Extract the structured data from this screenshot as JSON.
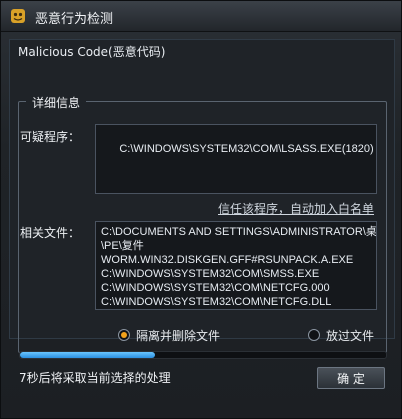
{
  "window": {
    "title": "恶意行为检测",
    "panel_caption": "Malicious Code(恶意代码)",
    "group_title": "详细信息"
  },
  "details": {
    "program_label": "可疑程序：",
    "program_path": "C:\\WINDOWS\\SYSTEM32\\COM\\LSASS.EXE(1820)",
    "trust_link": "信任该程序，自动加入白名单",
    "files_label": "相关文件：",
    "files": [
      "C:\\DOCUMENTS AND SETTINGS\\ADMINISTRATOR\\桌面",
      "\\PE\\复件",
      "WORM.WIN32.DISKGEN.GFF#RSUNPACK.A.EXE",
      "C:\\WINDOWS\\SYSTEM32\\COM\\SMSS.EXE",
      "C:\\WINDOWS\\SYSTEM32\\COM\\NETCFG.000",
      "C:\\WINDOWS\\SYSTEM32\\COM\\NETCFG.DLL"
    ]
  },
  "options": {
    "isolate_label": "隔离并删除文件",
    "skip_label": "放过文件",
    "selected": "isolate"
  },
  "progress": {
    "fraction": 0.37,
    "color": "#3aa3f0"
  },
  "status": {
    "countdown_text": "7秒后将采取当前选择的处理"
  },
  "buttons": {
    "ok_label": "确 定"
  }
}
